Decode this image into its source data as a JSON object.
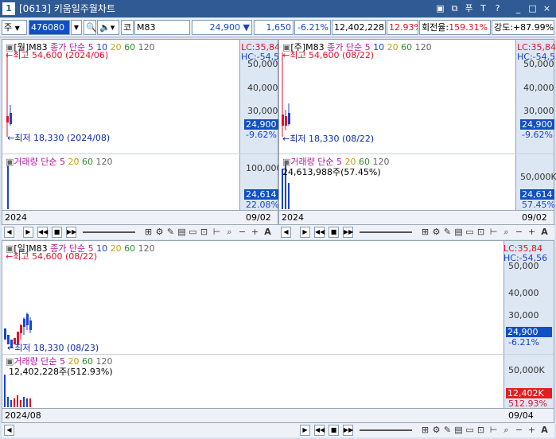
{
  "window": {
    "number": "1",
    "title": "[0613] 키움일주월차트",
    "controls": [
      "▣",
      "⧉",
      "푸",
      "T",
      "?",
      "_",
      "□",
      "×"
    ]
  },
  "toolbar": {
    "market": "주",
    "code": "476080",
    "code_prefix": "코",
    "name": "M83",
    "price": "24,900",
    "direction": "▼",
    "change": "1,650",
    "change_pct": "-6.21%",
    "volume": "12,402,228",
    "volume_pct": "12.93%",
    "turnover_label": "회전율:",
    "turnover": "159.31%",
    "strength_label": "강도:",
    "strength": "+87.99%"
  },
  "legend": {
    "price_name_monthly": "[월]M83",
    "price_name_weekly": "[주]M83",
    "close_label": "종가 단순",
    "ma": [
      "5",
      "10",
      "20",
      "60",
      "120"
    ],
    "volume_name": "거래량",
    "vol_ma_label": "단순",
    "vol_ma": [
      "5",
      "20",
      "60",
      "120"
    ]
  },
  "panel_monthly": {
    "high": "최고 54,600 (2024/06)",
    "low": "최저 18,330 (2024/08)",
    "lc": "LC:35,84",
    "hc": "HC:-54,5",
    "y_ticks": [
      "50,000",
      "40,000",
      "30,000"
    ],
    "price_label": "24,900",
    "pct_label": "-9.62%",
    "vol_tick": "100,000",
    "vol_label": "24,614",
    "vol_pct": "22.08%",
    "x_left": "2024",
    "x_right": "09/02"
  },
  "panel_weekly": {
    "high": "최고 54,600 (08/22)",
    "low": "최저 18,330 (08/22)",
    "lc": "LC:35,84",
    "hc": "HC:-54,5",
    "y_ticks": [
      "50,000",
      "40,000",
      "30,000"
    ],
    "price_label": "24,900",
    "pct_label": "-9.62%",
    "vol_text": "24,613,988주(57.45%)",
    "vol_tick": "50,000K",
    "vol_label": "24,614",
    "vol_pct": "57.45%",
    "x_left": "2024",
    "x_right": "09/02"
  },
  "panel_daily": {
    "name": "[일]M83",
    "high": "최고 54,600 (08/22)",
    "low": "최저 18,330 (08/23)",
    "lc": "LC:35,84",
    "hc": "HC:-54,56",
    "y_ticks": [
      "50,000",
      "40,000",
      "30,000"
    ],
    "price_label": "24,900",
    "pct_label": "-6.21%",
    "vol_text": "12,402,228주(512.93%)",
    "vol_tick": "50,000K",
    "vol_label": "12,402K",
    "vol_pct": "512.93%",
    "x_left": "2024/08",
    "x_right": "09/04"
  },
  "chart_controls": {
    "a_label": "A"
  },
  "colors": {
    "up": "#e0112b",
    "down": "#1a43c9",
    "accent": "#1050c4",
    "title_bar": "#2f5a93"
  }
}
